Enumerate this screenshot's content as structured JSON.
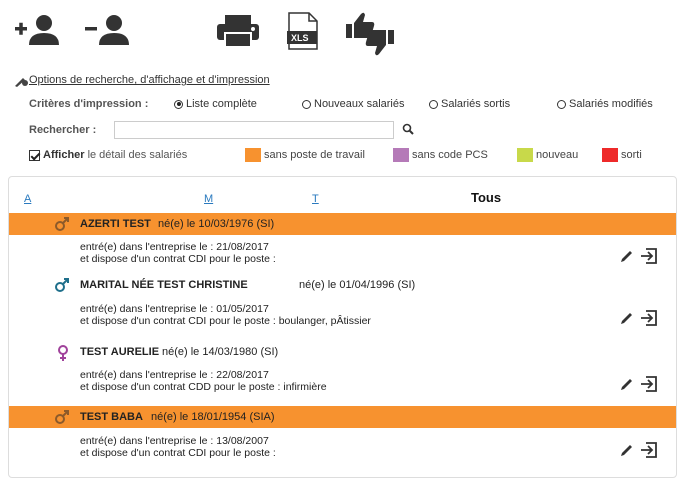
{
  "toolbar": {
    "add_employee": "add-employee-icon",
    "remove_employee": "remove-employee-icon",
    "print": "printer-icon",
    "export_xls_label": "XLS",
    "thumbs": "thumbs-icon"
  },
  "options_link": "Options de recherche, d'affichage et d'impression",
  "criteria": {
    "label": "Critères d'impression :",
    "options": [
      {
        "label": "Liste complète",
        "selected": true
      },
      {
        "label": "Nouveaux salariés",
        "selected": false
      },
      {
        "label": "Salariés sortis",
        "selected": false
      },
      {
        "label": "Salariés modifiés",
        "selected": false
      }
    ]
  },
  "search": {
    "label": "Rechercher :",
    "value": "",
    "placeholder": ""
  },
  "detail": {
    "bold": "Afficher",
    "rest": "le détail des salariés",
    "checked": true
  },
  "legend": [
    {
      "label": "sans poste de travail",
      "color": "#f7922f"
    },
    {
      "label": "sans code PCS",
      "color": "#b57ab8"
    },
    {
      "label": "nouveau",
      "color": "#c8d94a"
    },
    {
      "label": "sorti",
      "color": "#ee2a2a"
    }
  ],
  "sort": {
    "a": "A",
    "m": "M",
    "t": "T",
    "all": "Tous"
  },
  "employees": [
    {
      "name": "AZERTI TEST",
      "birth": "né(e) le 10/03/1976 (SI)",
      "gender": "male",
      "highlight": "#f7922f",
      "line1": "entré(e) dans l'entreprise le : 21/08/2017",
      "line2": "et dispose d'un contrat CDI pour le poste :"
    },
    {
      "name": "MARITAL NÉE TEST CHRISTINE",
      "birth": "né(e) le 01/04/1996 (SI)",
      "gender": "male",
      "highlight": "",
      "line1": "entré(e) dans l'entreprise le : 01/05/2017",
      "line2": "et dispose d'un contrat CDI pour le poste : boulanger, pÂtissier"
    },
    {
      "name": "TEST AURELIE",
      "birth": "né(e) le 14/03/1980 (SI)",
      "gender": "female",
      "highlight": "",
      "line1": "entré(e) dans l'entreprise le : 22/08/2017",
      "line2": "et dispose d'un contrat CDD pour le poste : infirmière"
    },
    {
      "name": "TEST BABA",
      "birth": "né(e) le 18/01/1954 (SIA)",
      "gender": "male",
      "highlight": "#f7922f",
      "line1": "entré(e) dans l'entreprise le : 13/08/2007",
      "line2": "et dispose d'un contrat CDI pour le poste :"
    }
  ],
  "colors": {
    "male": "#1f6f8b",
    "female": "#a0429b",
    "link": "#2a7abf"
  }
}
